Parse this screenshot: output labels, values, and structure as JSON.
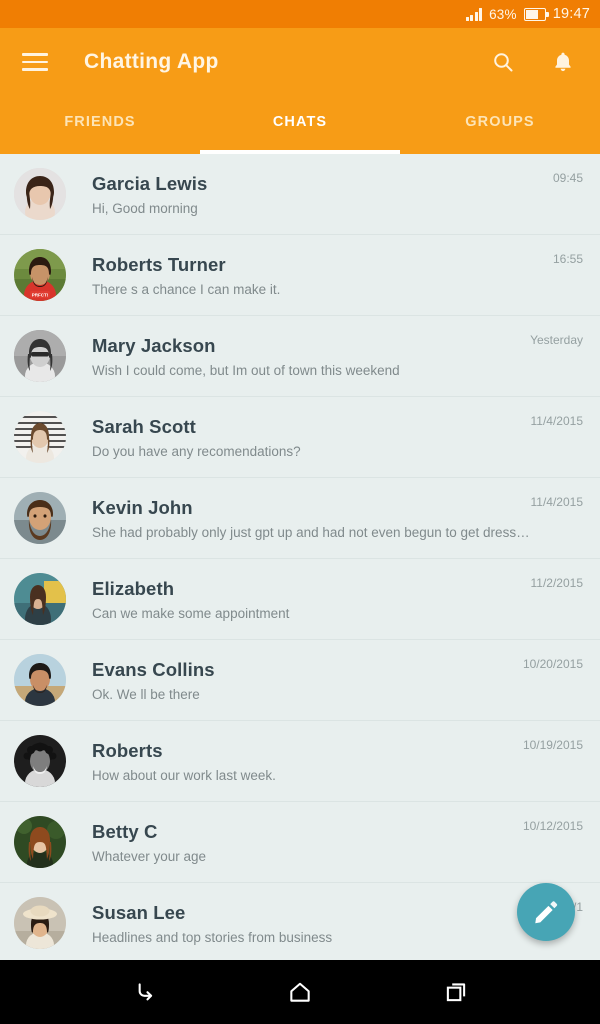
{
  "status_bar": {
    "signal_icon": "signal-bars-icon",
    "battery_percent": "63%",
    "battery_icon": "battery-icon",
    "time": "19:47"
  },
  "app_bar": {
    "menu_icon": "hamburger-menu-icon",
    "title": "Chatting App",
    "search_icon": "search-icon",
    "notification_icon": "bell-icon"
  },
  "tabs": [
    {
      "label": "FRIENDS",
      "active": false
    },
    {
      "label": "CHATS",
      "active": true
    },
    {
      "label": "GROUPS",
      "active": false
    }
  ],
  "chats": [
    {
      "name": "Garcia Lewis",
      "message": "Hi, Good morning",
      "time": "09:45",
      "avatar": "woman-dark-hair"
    },
    {
      "name": "Roberts Turner",
      "message": "There s a chance I can make it.",
      "time": "16:55",
      "avatar": "man-red-shirt"
    },
    {
      "name": "Mary Jackson",
      "message": "Wish I could come, but Im out of town this weekend",
      "time": "Yesterday",
      "avatar": "woman-bw-sunglasses"
    },
    {
      "name": "Sarah Scott",
      "message": "Do you have any recomendations?",
      "time": "11/4/2015",
      "avatar": "woman-striped-bw"
    },
    {
      "name": "Kevin John",
      "message": "She had probably only just gpt up and had not even begun to get dressed",
      "time": "11/4/2015",
      "avatar": "man-beard"
    },
    {
      "name": "Elizabeth",
      "message": "Can we make some appointment",
      "time": "11/2/2015",
      "avatar": "woman-teal-backdrop"
    },
    {
      "name": "Evans Collins",
      "message": "Ok. We ll be there",
      "time": "10/20/2015",
      "avatar": "man-short-hair"
    },
    {
      "name": "Roberts",
      "message": "How about our work last week.",
      "time": "10/19/2015",
      "avatar": "man-curly-bw"
    },
    {
      "name": "Betty C",
      "message": "Whatever your age",
      "time": "10/12/2015",
      "avatar": "woman-red-hair"
    },
    {
      "name": "Susan Lee",
      "message": "Headlines and top stories from business",
      "time": "10/1",
      "avatar": "woman-hat"
    }
  ],
  "fab": {
    "icon": "edit-pencil-icon",
    "color": "#47A5B5"
  },
  "nav_bar": {
    "back_icon": "back-arrow-icon",
    "home_icon": "home-icon",
    "recents_icon": "recent-apps-icon"
  },
  "colors": {
    "status_bar": "#F07E03",
    "app_bar": "#F79C16",
    "list_background": "#E8EFEE",
    "accent": "#47A5B5",
    "title_text": "#37474F",
    "secondary_text": "#808A8C"
  }
}
